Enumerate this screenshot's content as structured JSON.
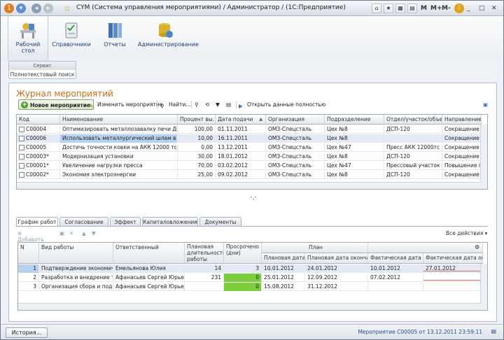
{
  "window": {
    "title": "CYM (Система управления мероприятиями) / Администратор / (1С:Предприятие)",
    "m_labels": [
      "M",
      "M+",
      "M-"
    ]
  },
  "sections": [
    {
      "label": "Рабочий стол"
    },
    {
      "label": "Справочники"
    },
    {
      "label": "Отчеты"
    },
    {
      "label": "Администрирование"
    }
  ],
  "service": {
    "caption": "Сервис",
    "item": "Полнотекстовый поиск"
  },
  "journal": {
    "title": "Журнал мероприятий"
  },
  "toolbar": {
    "new": "Новое мероприятие",
    "edit": "Изменить мероприятие",
    "find": "Найти...",
    "open_full": "Открыть данные полностью"
  },
  "top_grid": {
    "headers": [
      "Код",
      "Наименование",
      "Процент вы...",
      "Дата подачи",
      "Организация",
      "Подразделение",
      "Отдел/участок/объект",
      "Направление"
    ],
    "rows": [
      [
        "С00004",
        "Оптимизировать металлозавалку печи ДСП ...",
        "100,00",
        "01.11.2011",
        "ОМЗ-Спецсталь",
        "Цех №8",
        "ДСП-120",
        "Сокращение за"
      ],
      [
        "С00006",
        "Использовать металлургический шлам в зав...",
        "10,00",
        "16.11.2011",
        "ОМЗ-Спецсталь",
        "Цех №8",
        "",
        "Сокращение за"
      ],
      [
        "С00005",
        "Достичь точности ковки на АКК 12000 тс по к...",
        "0,00",
        "13.12.2011",
        "ОМЗ-Спецсталь",
        "Цех №47",
        "Пресс АКК 12000тс",
        "Сокращение за"
      ],
      [
        "С00003*",
        "Модернизация установки",
        "30,00",
        "18.01.2012",
        "ОМЗ-Спецсталь",
        "Цех №8",
        "ДСП-120",
        "Сокращение за"
      ],
      [
        "С00001*",
        "Увеличение нагрузки пресса",
        "70,00",
        "03.02.2012",
        "ОМЗ-Спецсталь",
        "Цех №47",
        "Прессовый участок",
        "Повышение про"
      ],
      [
        "С00002*",
        "Экономия электроэнергии",
        "25,00",
        "09.02.2012",
        "ОМЗ-Спецсталь",
        "Цех №8",
        "ДСП-120",
        "Сокращение за"
      ]
    ]
  },
  "tabs": [
    "График работ",
    "Согласование",
    "Эффект",
    "Капиталовложения",
    "Документы"
  ],
  "plan_toolbar": {
    "add": "Добавить",
    "all_actions": "Все действия"
  },
  "bottom_grid": {
    "headers": {
      "n": "N",
      "type": "Вид работы",
      "resp": "Ответственный",
      "dur": "Плановая длительность работы (дни)",
      "overdue": "Просрочено (дни)",
      "plan": "План",
      "plan_start": "Плановая дата ...",
      "plan_end": "Плановая дата оконча...",
      "fact_start": "Фактическая дата ...",
      "fact_end": "Фактическая дата оконч...",
      "f": "Ф"
    },
    "rows": [
      [
        "1",
        "Подтверждение экономич...",
        "Емельянова Юлия",
        "14",
        "3",
        "10.01.2012",
        "24.01.2012",
        "10.01.2012",
        "27.01.2012"
      ],
      [
        "2",
        "Разработка и внедрение т...",
        "Афанасьев Сергей Юрьев...",
        "231",
        "0",
        "25.01.2012",
        "12.09.2012",
        "07.02.2012",
        ""
      ],
      [
        "3",
        "Организация сбора и подг...",
        "Афанасьев Сергей Юрьев...",
        "",
        "0",
        "15.08.2012",
        "31.12.2012",
        "",
        ""
      ]
    ]
  },
  "footer": {
    "history": "История...",
    "status": "Мероприятие С00005 от 13.12.2011 23:59:11"
  },
  "colors": {
    "accent": "#cc6b1b",
    "selection": "#b8d0ef",
    "overdue_ok": "#7ccd3b"
  }
}
